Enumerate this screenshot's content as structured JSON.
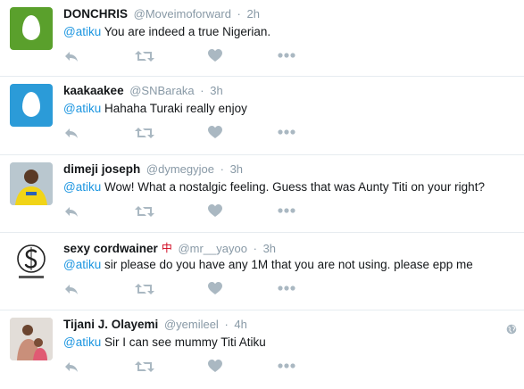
{
  "colors": {
    "name": "#14171a",
    "meta": "#8899a6",
    "mention": "#1b95e0",
    "action": "#aab8c2",
    "divider": "#e6ecf0"
  },
  "tweets": [
    {
      "name": "DONCHRIS",
      "handle": "@Moveimoforward",
      "dot": "·",
      "time": "2h",
      "mention": "@atiku",
      "text": " You are indeed a true Nigerian.",
      "avatar": "egg-green"
    },
    {
      "name": "kaakaakee",
      "handle": "@SNBaraka",
      "dot": "·",
      "time": "3h",
      "mention": "@atiku",
      "text": " Hahaha Turaki really enjoy",
      "avatar": "egg-blue"
    },
    {
      "name": "dimeji joseph",
      "handle": "@dymegyjoe",
      "dot": "·",
      "time": "3h",
      "mention": "@atiku",
      "text": " Wow! What a nostalgic feeling. Guess that was Aunty Titi on your right?",
      "avatar": "photo-yellow"
    },
    {
      "name": "sexy cordwainer",
      "flag": "中",
      "handle": "@mr__yayoo",
      "dot": "·",
      "time": "3h",
      "mention": "@atiku",
      "text": " sir please do you have any 1M that you are not using. please epp me",
      "avatar": "logo-s"
    },
    {
      "name": "Tijani J. Olayemi",
      "handle": "@yemileel",
      "dot": "·",
      "time": "4h",
      "mention": "@atiku",
      "text": " Sir I can see mummy Titi Atiku",
      "avatar": "photo-family",
      "globe": "globe-icon"
    }
  ],
  "icons": {
    "reply": "reply-icon",
    "retweet": "retweet-icon",
    "like": "heart-icon",
    "more": "more-icon"
  }
}
